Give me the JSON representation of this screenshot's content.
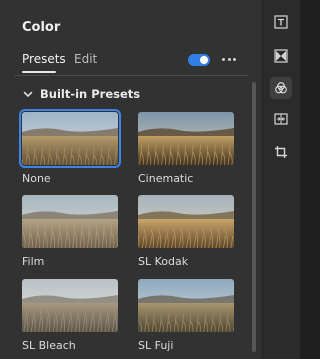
{
  "panel": {
    "title": "Color"
  },
  "tabs": [
    {
      "label": "Presets",
      "active": true
    },
    {
      "label": "Edit",
      "active": false
    }
  ],
  "toggle": {
    "enabled": true,
    "color": "#2f7fe5"
  },
  "section": {
    "label": "Built-in Presets",
    "expanded": true
  },
  "presets": [
    {
      "label": "None",
      "selected": true,
      "style": "neutral"
    },
    {
      "label": "Cinematic",
      "selected": false,
      "style": "warm-contrast"
    },
    {
      "label": "Film",
      "selected": false,
      "style": "faded"
    },
    {
      "label": "SL Kodak",
      "selected": false,
      "style": "warm"
    },
    {
      "label": "SL Bleach",
      "selected": false,
      "style": "bleach"
    },
    {
      "label": "SL Fuji",
      "selected": false,
      "style": "cool"
    }
  ],
  "rail": {
    "icons": [
      {
        "name": "title-text-icon",
        "active": false
      },
      {
        "name": "transitions-icon",
        "active": false
      },
      {
        "name": "color-circles-icon",
        "active": true
      },
      {
        "name": "speed-icon",
        "active": false
      },
      {
        "name": "crop-icon",
        "active": false
      }
    ]
  },
  "colors": {
    "panel_bg": "#323232",
    "rail_bg": "#2b2b2b",
    "accent": "#2f7fe5",
    "selection": "#3c84e8"
  }
}
